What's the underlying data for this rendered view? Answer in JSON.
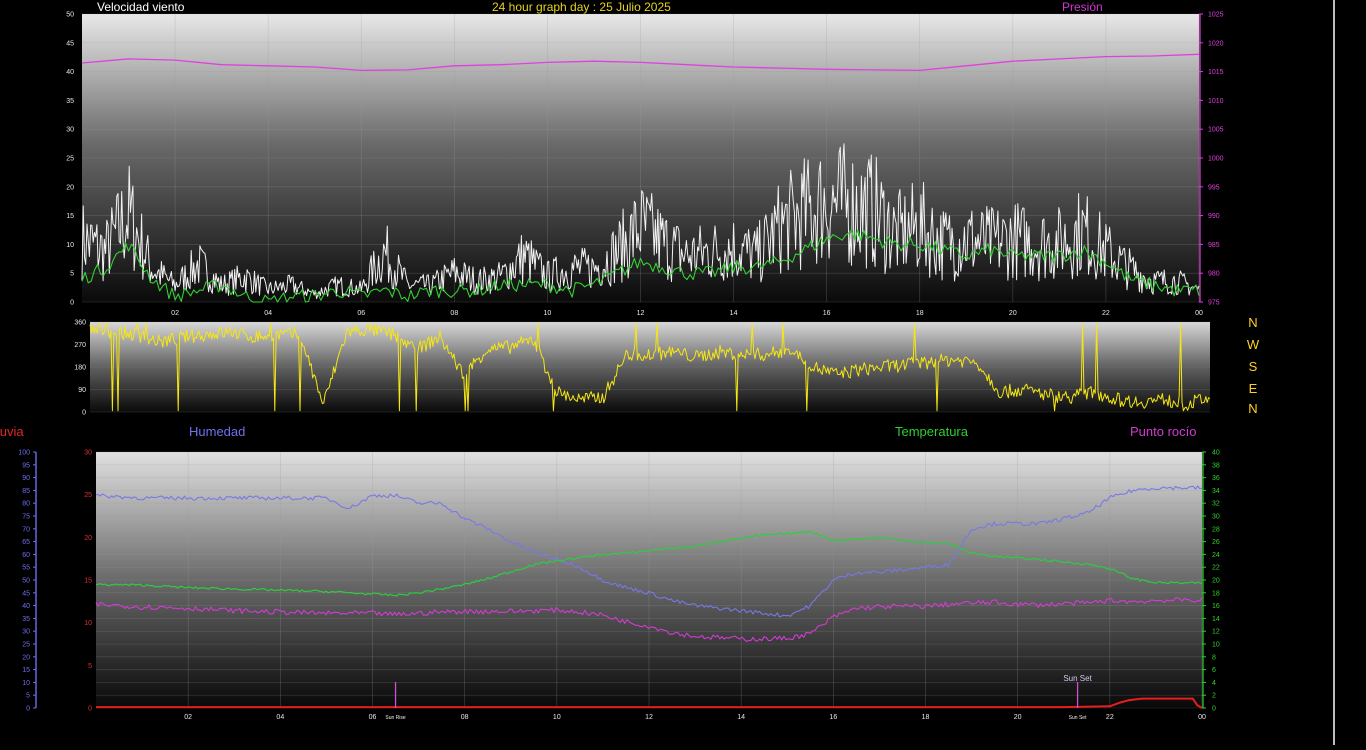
{
  "header": {
    "wind_title": "Velocidad viento",
    "main_title": "24 hour graph day : 25 Julio 2025",
    "pressure_title": "Presión"
  },
  "middle": {
    "directions": [
      "N",
      "W",
      "S",
      "E",
      "N"
    ]
  },
  "bottom_titles": {
    "rain": "lluvia",
    "humidity": "Humedad",
    "temperature": "Temperatura",
    "dewpoint": "Punto rocío"
  },
  "annotations": {
    "sunrise": "Sun Rise",
    "sunset": "Sun Set",
    "sunset_short": "Sun Set"
  },
  "colors": {
    "wind_gust": "#f2f2f2",
    "wind_avg": "#32d232",
    "pressure": "#e040e0",
    "direction": "#f5e614",
    "humidity": "#7878e6",
    "temperature": "#2ecc40",
    "dewpoint": "#d23cd2",
    "rain": "#e61e1e",
    "rain_axis": "#e03030",
    "humidity_axis": "#6e6ef0",
    "temp_axis": "#30d030"
  },
  "chart_data": [
    {
      "type": "line",
      "title": "Velocidad viento",
      "x_ticks": [
        "02",
        "04",
        "06",
        "08",
        "10",
        "12",
        "14",
        "16",
        "18",
        "20",
        "22",
        "00"
      ],
      "y_left_ticks": [
        0,
        5,
        10,
        15,
        20,
        25,
        30,
        35,
        40,
        45,
        50
      ],
      "ylim_left": [
        0,
        50
      ],
      "y_right_ticks": [
        975,
        980,
        985,
        990,
        995,
        1000,
        1005,
        1010,
        1015,
        1020,
        1025
      ],
      "ylim_right": [
        975,
        1025
      ],
      "series": [
        {
          "name": "Velocidad viento",
          "axis": "left",
          "x": [
            0,
            0.5,
            1,
            1.5,
            2,
            2.5,
            3,
            3.5,
            4,
            4.5,
            5,
            5.5,
            6,
            6.5,
            7,
            7.5,
            8,
            8.5,
            9,
            9.5,
            10,
            10.5,
            11,
            11.5,
            12,
            12.5,
            13,
            13.5,
            14,
            14.5,
            15,
            15.5,
            16,
            16.5,
            17,
            17.5,
            18,
            18.5,
            19,
            19.5,
            20,
            20.5,
            21,
            21.5,
            22,
            22.5,
            23,
            23.5,
            24
          ],
          "values": [
            15,
            12,
            21,
            8,
            4,
            9,
            4,
            6,
            3,
            4,
            2,
            4,
            3,
            12,
            4,
            4,
            7,
            5,
            6,
            11,
            6,
            8,
            8,
            12,
            18,
            14,
            11,
            12,
            13,
            11,
            18,
            21,
            24,
            23,
            22,
            16,
            18,
            14,
            15,
            14,
            15,
            14,
            14,
            17,
            12,
            8,
            5,
            5,
            3
          ]
        },
        {
          "name": "Velocidad viento media",
          "axis": "left",
          "x": [
            0,
            0.5,
            1,
            1.5,
            2,
            2.5,
            3,
            3.5,
            4,
            4.5,
            5,
            5.5,
            6,
            6.5,
            7,
            7.5,
            8,
            8.5,
            9,
            9.5,
            10,
            10.5,
            11,
            11.5,
            12,
            12.5,
            13,
            13.5,
            14,
            14.5,
            15,
            15.5,
            16,
            16.5,
            17,
            17.5,
            18,
            18.5,
            19,
            19.5,
            20,
            20.5,
            21,
            21.5,
            22,
            22.5,
            23,
            23.5,
            24
          ],
          "values": [
            4,
            6,
            10,
            4,
            1,
            2,
            3,
            1,
            0,
            1,
            1,
            2,
            1,
            2,
            1,
            2,
            2,
            2,
            3,
            3,
            3,
            2,
            3,
            5,
            7,
            6,
            5,
            5,
            6,
            6,
            7,
            9,
            11,
            12,
            11,
            10,
            10,
            9,
            8,
            9,
            8,
            8,
            8,
            9,
            7,
            4,
            3,
            2,
            2
          ]
        },
        {
          "name": "Presión",
          "axis": "right",
          "x": [
            0,
            1,
            2,
            3,
            4,
            5,
            6,
            7,
            8,
            9,
            10,
            11,
            12,
            13,
            14,
            15,
            16,
            17,
            18,
            19,
            20,
            21,
            22,
            23,
            24
          ],
          "values": [
            1016.5,
            1017.2,
            1017,
            1016.2,
            1016,
            1015.8,
            1015.2,
            1015.3,
            1016,
            1016.2,
            1016.6,
            1016.8,
            1016.6,
            1016.2,
            1015.8,
            1015.6,
            1015.4,
            1015.3,
            1015.2,
            1016,
            1016.8,
            1017.2,
            1017.6,
            1017.7,
            1018
          ]
        }
      ]
    },
    {
      "type": "line",
      "title": "",
      "x_ticks": [],
      "y_ticks": [
        0,
        90,
        180,
        270,
        360
      ],
      "ylim": [
        0,
        360
      ],
      "series": [
        {
          "name": "",
          "x": [
            0,
            0.5,
            1,
            1.5,
            2,
            2.5,
            3,
            3.5,
            4,
            4.5,
            5,
            5.5,
            6,
            6.5,
            7,
            7.5,
            8,
            8.5,
            9,
            9.5,
            10,
            10.5,
            11,
            11.5,
            12,
            12.5,
            13,
            13.5,
            14,
            14.5,
            15,
            15.5,
            16,
            16.5,
            17,
            17.5,
            18,
            18.5,
            19,
            19.5,
            20,
            20.5,
            21,
            21.5,
            22,
            22.5,
            23,
            23.5,
            24
          ],
          "values": [
            330,
            320,
            310,
            280,
            300,
            310,
            320,
            300,
            310,
            310,
            30,
            320,
            330,
            310,
            250,
            300,
            150,
            250,
            260,
            290,
            80,
            50,
            60,
            230,
            230,
            240,
            220,
            240,
            230,
            230,
            250,
            180,
            150,
            170,
            180,
            190,
            200,
            210,
            200,
            80,
            90,
            70,
            60,
            80,
            50,
            40,
            50,
            30,
            60
          ]
        }
      ]
    },
    {
      "type": "line",
      "title": "",
      "x_ticks": [
        "02",
        "04",
        "06",
        "08",
        "10",
        "12",
        "14",
        "16",
        "18",
        "20",
        "22",
        "00"
      ],
      "y_rain_ticks": [
        0,
        5,
        10,
        15,
        20,
        25,
        30
      ],
      "ylim_rain": [
        0,
        30
      ],
      "y_humidity_ticks": [
        0,
        5,
        10,
        15,
        20,
        25,
        30,
        35,
        40,
        45,
        50,
        55,
        60,
        65,
        70,
        75,
        80,
        85,
        90,
        95,
        100
      ],
      "ylim_humidity": [
        0,
        100
      ],
      "y_temp_ticks": [
        0,
        2,
        4,
        6,
        8,
        10,
        12,
        14,
        16,
        18,
        20,
        22,
        24,
        26,
        28,
        30,
        32,
        34,
        36,
        38,
        40
      ],
      "ylim_temp": [
        0,
        40
      ],
      "series": [
        {
          "name": "Humedad",
          "axis": "humidity",
          "x": [
            0,
            1,
            2,
            3,
            4,
            5,
            5.5,
            6,
            6.5,
            7,
            7.5,
            8,
            8.5,
            9,
            9.5,
            10,
            10.5,
            11,
            11.5,
            12,
            12.5,
            13,
            13.5,
            14,
            14.5,
            15,
            15.5,
            16,
            16.5,
            17,
            17.5,
            18,
            18.5,
            19,
            19.5,
            20,
            20.5,
            21,
            21.5,
            22,
            22.5,
            23,
            24
          ],
          "values": [
            83,
            82,
            82,
            82,
            82,
            82,
            78,
            83,
            83,
            80,
            80,
            74,
            70,
            65,
            61,
            58,
            55,
            50,
            47,
            45,
            42,
            40,
            39,
            38,
            37,
            36,
            40,
            50,
            53,
            53,
            54,
            55,
            56,
            70,
            72,
            72,
            72,
            74,
            76,
            82,
            85,
            86,
            86
          ]
        },
        {
          "name": "Temperatura",
          "axis": "temp",
          "x": [
            0,
            1,
            2,
            3,
            4,
            5,
            5.5,
            6,
            6.5,
            7,
            7.5,
            8,
            8.5,
            9,
            9.5,
            10,
            10.5,
            11,
            11.5,
            12,
            12.5,
            13,
            13.5,
            14,
            14.5,
            15,
            15.5,
            16,
            16.5,
            17,
            17.5,
            18,
            18.5,
            19,
            19.5,
            20,
            20.5,
            21,
            21.5,
            22,
            22.5,
            23,
            24
          ],
          "values": [
            19.3,
            19.2,
            18.8,
            18.6,
            18.4,
            18.2,
            18,
            17.8,
            17.6,
            18,
            18.6,
            19.3,
            20.2,
            21.3,
            22.4,
            23,
            23.5,
            24,
            24.2,
            24.6,
            25,
            25.2,
            26,
            26.5,
            27,
            27.2,
            27.6,
            26.2,
            26.4,
            26.6,
            26.3,
            25.8,
            25.7,
            24.2,
            23.7,
            23.4,
            23.2,
            22.8,
            22.5,
            21.8,
            20.2,
            19.6,
            19.5
          ]
        },
        {
          "name": "Punto rocío",
          "axis": "temp",
          "x": [
            0,
            1,
            2,
            3,
            4,
            5,
            5.5,
            6,
            6.5,
            7,
            7.5,
            8,
            8.5,
            9,
            9.5,
            10,
            10.5,
            11,
            11.5,
            12,
            12.5,
            13,
            13.5,
            14,
            14.5,
            15,
            15.5,
            16,
            16.5,
            17,
            17.5,
            18,
            18.5,
            19,
            19.5,
            20,
            20.5,
            21,
            21.5,
            22,
            22.5,
            23,
            24
          ],
          "values": [
            16.2,
            15.8,
            15.6,
            15.2,
            15,
            14.8,
            14.8,
            14.8,
            14.6,
            14.8,
            15,
            15.1,
            15.1,
            15.1,
            15.2,
            15.3,
            15,
            14.5,
            13.5,
            12.8,
            11.8,
            11.2,
            11,
            10.8,
            10.8,
            10.9,
            11.6,
            14.2,
            15.6,
            15.8,
            15.9,
            15.9,
            16.2,
            16.4,
            16.5,
            16.2,
            16.1,
            16.3,
            16.4,
            16.8,
            16.6,
            16.8,
            16.9
          ]
        },
        {
          "name": "lluvia",
          "axis": "rain",
          "x": [
            0,
            21,
            22,
            22.2,
            22.4,
            22.7,
            23,
            23.8,
            23.9,
            24
          ],
          "values": [
            0.1,
            0.1,
            0.2,
            0.6,
            0.9,
            1.1,
            1.1,
            1.1,
            0.3,
            0
          ]
        }
      ],
      "events": [
        {
          "label": "Sun Rise",
          "x": 6.5
        },
        {
          "label": "Sun Set",
          "x": 21.3
        }
      ]
    }
  ]
}
